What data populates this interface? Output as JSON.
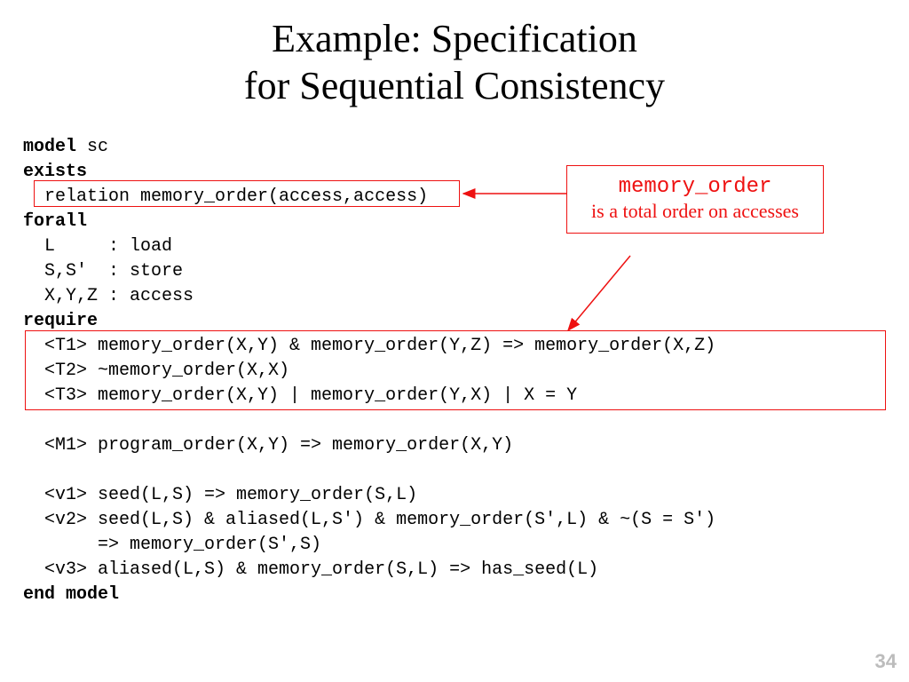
{
  "title": {
    "line1": "Example: Specification",
    "line2": "for Sequential Consistency"
  },
  "kw": {
    "model": "model",
    "exists": "exists",
    "forall": "forall",
    "require": "require",
    "end_model": "end model"
  },
  "code": {
    "model_name": " sc",
    "exists_line": "  relation memory_order(access,access)",
    "forall_lines": [
      "  L     : load",
      "  S,S'  : store",
      "  X,Y,Z : access"
    ],
    "require_lines": [
      "  <T1> memory_order(X,Y) & memory_order(Y,Z) => memory_order(X,Z)",
      "  <T2> ~memory_order(X,X)",
      "  <T3> memory_order(X,Y) | memory_order(Y,X) | X = Y",
      "",
      "  <M1> program_order(X,Y) => memory_order(X,Y)",
      "",
      "  <v1> seed(L,S) => memory_order(S,L)",
      "  <v2> seed(L,S) & aliased(L,S') & memory_order(S',L) & ~(S = S')",
      "       => memory_order(S',S)",
      "  <v3> aliased(L,S) & memory_order(S,L) => has_seed(L)"
    ]
  },
  "callout": {
    "mono": "memory_order",
    "text": "is a total order on accesses"
  },
  "page_number": "34"
}
